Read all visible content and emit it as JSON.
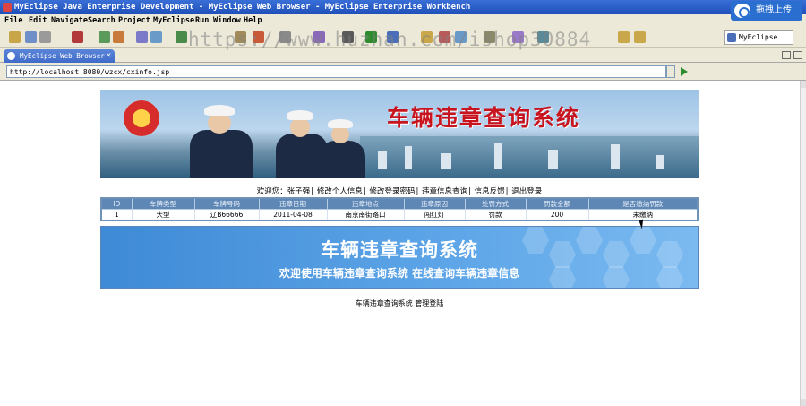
{
  "window": {
    "title": "MyEclipse Java Enterprise Development - MyEclipse Web Browser - MyEclipse Enterprise Workbench",
    "upload_label": "拖拽上传"
  },
  "menu": [
    "File",
    "Edit",
    "Navigate",
    "Search",
    "Project",
    "MyEclipse",
    "Run",
    "Window",
    "Help"
  ],
  "watermark": "https://www.huzhan.com/ishop30884",
  "perspective": "MyEclipse ...",
  "editor_tab": {
    "label": "MyEclipse Web Browser",
    "close": "✕"
  },
  "address": {
    "url": "http://localhost:8080/wzcx/cxinfo.jsp"
  },
  "banner": {
    "title": "车辆违章查询系统"
  },
  "nav": {
    "welcome": "欢迎您：张子强",
    "links": [
      "修改个人信息",
      "修改登录密码",
      "违章信息查询",
      "信息反馈",
      "退出登录"
    ]
  },
  "violations": {
    "headers": [
      "ID",
      "车牌类型",
      "车牌号码",
      "违章日期",
      "违章地点",
      "违章原因",
      "处罚方式",
      "罚款金额",
      "是否缴纳罚款"
    ],
    "rows": [
      [
        "1",
        "大型",
        "辽B66666",
        "2011-04-08",
        "南京南街路口",
        "闯红灯",
        "罚款",
        "200",
        "未缴纳"
      ]
    ]
  },
  "info_banner": {
    "title": "车辆违章查询系统",
    "subtitle": "欢迎使用车辆违章查询系统 在线查询车辆违章信息"
  },
  "footer": {
    "text": "车辆违章查询系统",
    "link": "管理登陆"
  },
  "colors": {
    "title_bar": "#1f4fb8",
    "table_header": "#5f87b5",
    "banner_title": "#c8141e",
    "info_banner": "#3f8ad6"
  }
}
